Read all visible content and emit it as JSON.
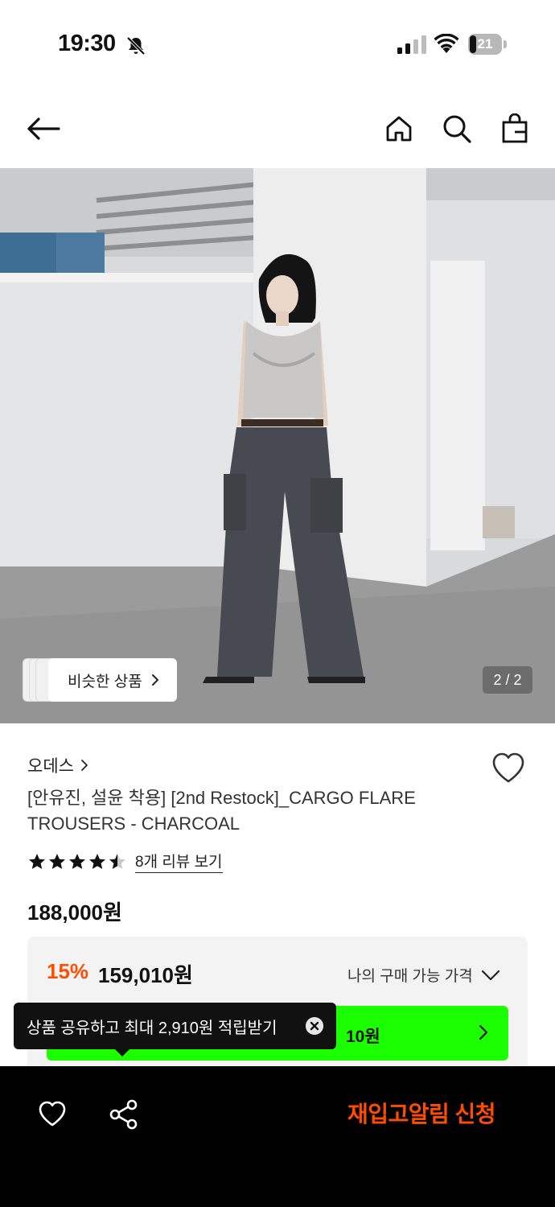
{
  "status_bar": {
    "time": "19:30",
    "battery": "21",
    "battery_level": 0.21
  },
  "nav": {
    "back_icon": "arrow-left-icon",
    "home_icon": "home-icon",
    "search_icon": "search-icon",
    "bag_icon": "shopping-bag-icon"
  },
  "gallery": {
    "similar_label": "비슷한 상품",
    "page_counter": "2 / 2"
  },
  "product": {
    "brand": "오데스",
    "title": "[안유진, 설윤 착용] [2nd Restock]_CARGO FLARE TROUSERS - CHARCOAL",
    "rating": 4.5,
    "review_link": "8개 리뷰 보기",
    "original_price": "188,000원"
  },
  "price_box": {
    "discount": "15%",
    "price": "159,010원",
    "my_price_label": "나의 구매 가능 가격",
    "green_bar_text": "10원"
  },
  "toast": {
    "text": "상품 공유하고 최대 2,910원 적립받기"
  },
  "bottom_bar": {
    "cta": "재입고알림 신청",
    "heart_icon": "heart-icon",
    "share_icon": "share-icon"
  },
  "colors": {
    "accent_orange": "#ff4d00",
    "green_bar": "#1cff00",
    "bottom_bar_bg": "#000000"
  }
}
